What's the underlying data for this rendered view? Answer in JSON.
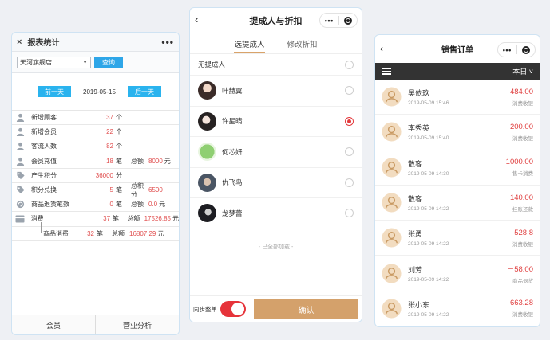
{
  "report": {
    "title": "报表统计",
    "close_icon": "×",
    "more_icon": "•••",
    "store": "天河旗舰店",
    "query": "查询",
    "prev_day": "前一天",
    "date": "2019-05-15",
    "next_day": "后一天",
    "rows": [
      {
        "icon": "person-icon",
        "label": "新增顾客",
        "value": "37",
        "unit": "个",
        "total_label": "",
        "total_value": "",
        "total_unit": ""
      },
      {
        "icon": "person-icon",
        "label": "新增会员",
        "value": "22",
        "unit": "个",
        "total_label": "",
        "total_value": "",
        "total_unit": ""
      },
      {
        "icon": "person-icon",
        "label": "客流人数",
        "value": "82",
        "unit": "个",
        "total_label": "",
        "total_value": "",
        "total_unit": ""
      },
      {
        "icon": "person-icon",
        "label": "会员充值",
        "value": "18",
        "unit": "笔",
        "total_label": "总额",
        "total_value": "8000",
        "total_unit": "元"
      },
      {
        "icon": "tag-icon",
        "label": "产生积分",
        "value": "36000",
        "unit": "分",
        "total_label": "",
        "total_value": "",
        "total_unit": ""
      },
      {
        "icon": "tag-icon",
        "label": "积分兑换",
        "value": "5",
        "unit": "笔",
        "total_label": "总积分",
        "total_value": "6500",
        "total_unit": ""
      },
      {
        "icon": "return-icon",
        "label": "商品退货笔数",
        "value": "0",
        "unit": "笔",
        "total_label": "总额",
        "total_value": "0.0",
        "total_unit": "元"
      },
      {
        "icon": "card-icon",
        "label": "消费",
        "value": "37",
        "unit": "笔",
        "total_label": "总额",
        "total_value": "17526.85",
        "total_unit": "元"
      }
    ],
    "sub_row": {
      "label": "商品消费",
      "value": "32",
      "unit": "笔",
      "total_label": "总额",
      "total_value": "16807.29",
      "total_unit": "元"
    },
    "footer": [
      "会员",
      "营业分析"
    ]
  },
  "commission": {
    "title": "提成人与折扣",
    "back_icon": "‹",
    "tabs": [
      "选提成人",
      "修改折扣"
    ],
    "none_label": "无提成人",
    "people": [
      {
        "name": "叶赫翼",
        "selected": false
      },
      {
        "name": "许星晴",
        "selected": true
      },
      {
        "name": "何芯妍",
        "selected": false
      },
      {
        "name": "仇飞鸟",
        "selected": false
      },
      {
        "name": "龙梦蕾",
        "selected": false
      }
    ],
    "loaded_text": "- 已全部加载 -",
    "sync_label": "同步整单",
    "confirm": "确认"
  },
  "orders": {
    "title": "销售订单",
    "period": "本日 ˅",
    "items": [
      {
        "name": "吴依玖",
        "time": "2019-05-09  15:46",
        "amount": "484.00",
        "type": "消费收银"
      },
      {
        "name": "李秀英",
        "time": "2019-05-09  15:40",
        "amount": "200.00",
        "type": "消费收银"
      },
      {
        "name": "散客",
        "time": "2019-05-09  14:30",
        "amount": "1000.00",
        "type": "售卡消费"
      },
      {
        "name": "散客",
        "time": "2019-05-09  14:22",
        "amount": "140.00",
        "type": "挂账还款"
      },
      {
        "name": "张勇",
        "time": "2019-05-09  14:22",
        "amount": "528.8",
        "type": "消费收银"
      },
      {
        "name": "刘芳",
        "time": "2019-05-09  14:22",
        "amount": "－58.00",
        "type": "商品退货"
      },
      {
        "name": "张小东",
        "time": "2019-05-09  14:22",
        "amount": "663.28",
        "type": "消费收银"
      }
    ]
  },
  "colors": {
    "accent_blue": "#2ab3ee",
    "gold": "#d4a16b",
    "red": "#e04040"
  }
}
